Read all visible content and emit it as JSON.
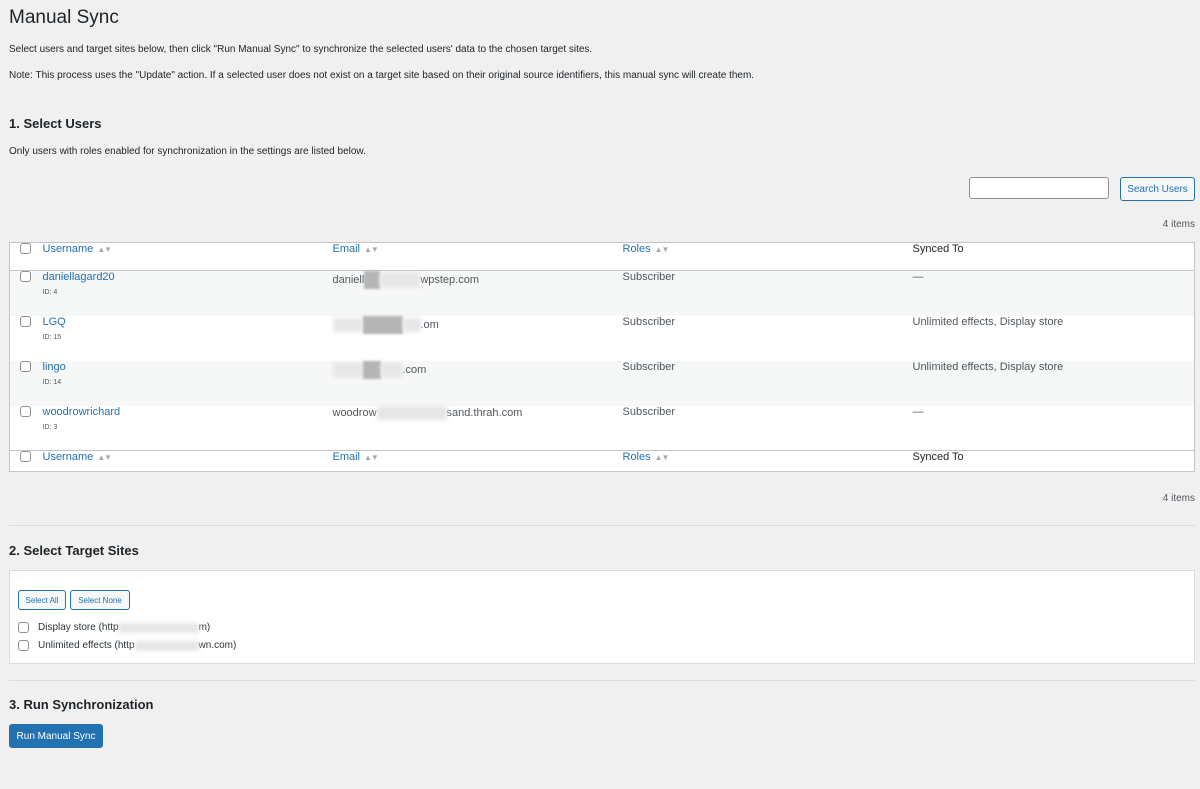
{
  "page": {
    "title": "Manual Sync",
    "description": "Select users and target sites below, then click \"Run Manual Sync\" to synchronize the selected users' data to the chosen target sites.",
    "note": "Note: This process uses the \"Update\" action. If a selected user does not exist on a target site based on their original source identifiers, this manual sync will create them."
  },
  "users_section": {
    "heading": "1. Select Users",
    "note": "Only users with roles enabled for synchronization in the settings are listed below.",
    "search_value": "",
    "search_button": "Search Users",
    "count_top": "4 items",
    "count_bottom": "4 items",
    "columns": {
      "username": "Username",
      "email": "Email",
      "roles": "Roles",
      "synced_to": "Synced To"
    },
    "rows": [
      {
        "username": "daniellagard20",
        "id": "ID: 4",
        "email_start": "daniell",
        "email_end": "wpstep.com",
        "role": "Subscriber",
        "synced": "—"
      },
      {
        "username": "LGQ",
        "id": "ID: 15",
        "email_start": "",
        "email_end": ".om",
        "role": "Subscriber",
        "synced": "Unlimited effects, Display store"
      },
      {
        "username": "lingo",
        "id": "ID: 14",
        "email_start": "",
        "email_end": ".com",
        "role": "Subscriber",
        "synced": "Unlimited effects, Display store"
      },
      {
        "username": "woodrowrichard",
        "id": "ID: 3",
        "email_start": "woodrow",
        "email_end": "sand.thrah.com",
        "role": "Subscriber",
        "synced": "—"
      }
    ]
  },
  "sites_section": {
    "heading": "2. Select Target Sites",
    "select_all": "Select All",
    "select_none": "Select None",
    "sites": [
      {
        "label_start": "Display store (http",
        "label_end": "m)"
      },
      {
        "label_start": "Unlimited effects (http",
        "label_end": "wn.com)"
      }
    ]
  },
  "run_section": {
    "heading": "3. Run Synchronization",
    "button": "Run Manual Sync"
  },
  "colors": {
    "accent": "#2271b1",
    "background": "#f0f0f1"
  }
}
